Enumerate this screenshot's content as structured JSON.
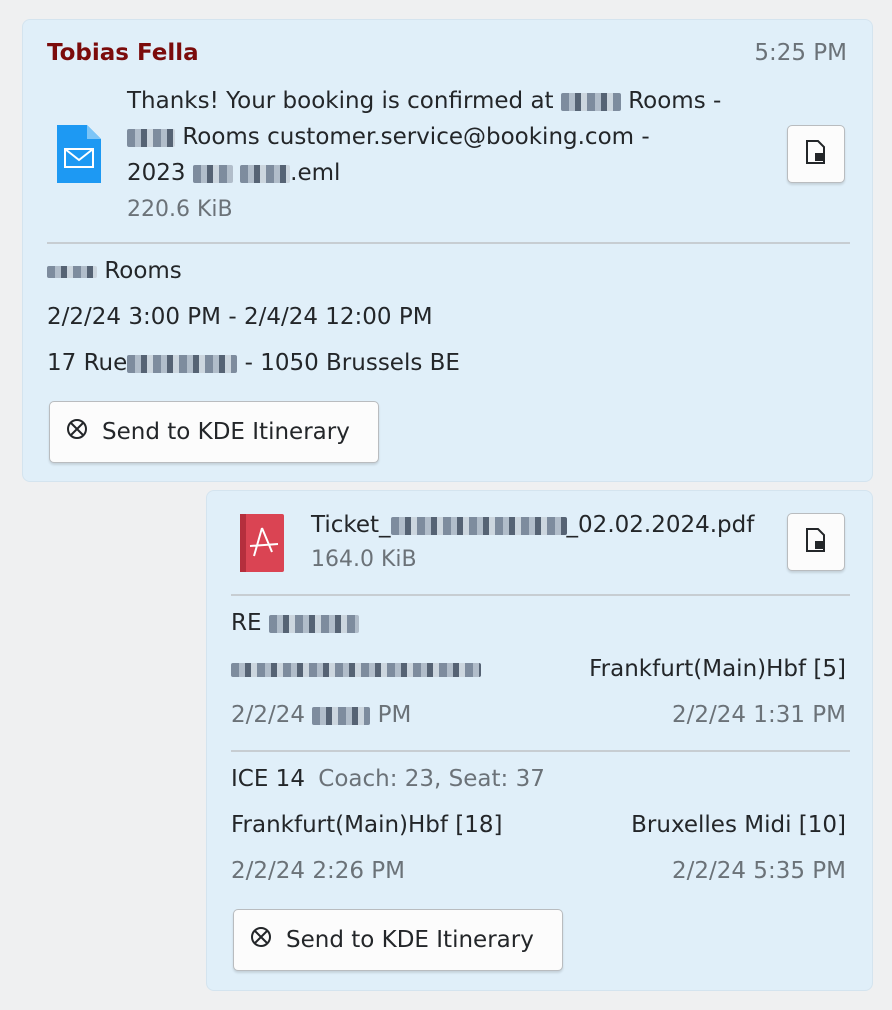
{
  "message1": {
    "sender": "Tobias Fella",
    "time": "5:25 PM",
    "file": {
      "name_part1": "Thanks! Your booking is confirmed at",
      "name_part2": "Rooms -",
      "name_part3": "Rooms customer.service@booking.com -",
      "name_part4": "2023",
      "name_part5": ".eml",
      "size": "220.6 KiB"
    },
    "hotel": {
      "name": "Rooms",
      "dates": "2/2/24 3:00 PM - 2/4/24 12:00 PM",
      "address_start": "17 Rue",
      "address_end": "- 1050 Brussels BE"
    },
    "action_label": "Send to KDE Itinerary"
  },
  "message2": {
    "file": {
      "name_start": "Ticket_",
      "name_end": "_02.02.2024.pdf",
      "size": "164.0 KiB"
    },
    "leg1": {
      "train": "RE",
      "to_station": "Frankfurt(Main)Hbf [5]",
      "dep_time_start": "2/2/24",
      "dep_time_end": "PM",
      "arr_time": "2/2/24 1:31 PM"
    },
    "leg2": {
      "train": "ICE 14",
      "seat": "Coach: 23, Seat: 37",
      "from_station": "Frankfurt(Main)Hbf [18]",
      "to_station": "Bruxelles Midi [10]",
      "dep_time": "2/2/24 2:26 PM",
      "arr_time": "2/2/24 5:35 PM"
    },
    "action_label": "Send to KDE Itinerary"
  },
  "icons": {
    "email_file": "email-file-icon",
    "pdf_file": "pdf-file-icon",
    "save": "save-file-icon",
    "itinerary": "itinerary-icon"
  },
  "colors": {
    "bubble": "#e0eff9",
    "sender": "#7b0b0b",
    "background": "#eff0f1"
  }
}
